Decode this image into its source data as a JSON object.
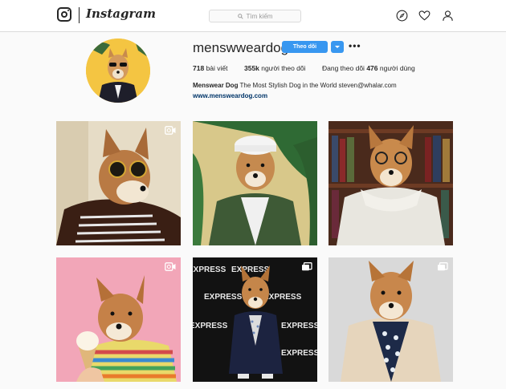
{
  "header": {
    "logo_text": "Instagram",
    "search_placeholder": "Tìm kiếm",
    "icons": [
      "instagram-camera-icon",
      "explore-compass-icon",
      "heart-icon",
      "profile-user-icon"
    ]
  },
  "profile": {
    "username": "menswweardog",
    "follow_label": "Theo dõi",
    "more_label": "•••",
    "stats": {
      "posts_count": "718",
      "posts_label": "bài viết",
      "followers_count": "355k",
      "followers_label": "người theo dõi",
      "following_prefix": "Đang theo dõi",
      "following_count": "476",
      "following_label": "người dùng"
    },
    "bio_name": "Menswear Dog",
    "bio_text": "The Most Stylish Dog in the World steven@whalar.com",
    "website": "www.mensweardog.com"
  },
  "posts": [
    {
      "kind": "video",
      "badge": "video-camera-icon"
    },
    {
      "kind": "photo",
      "badge": ""
    },
    {
      "kind": "photo",
      "badge": ""
    },
    {
      "kind": "video",
      "badge": "video-camera-icon"
    },
    {
      "kind": "carousel",
      "badge": "carousel-icon",
      "backdrop_text": [
        "EXPRESS",
        "EXPRESS",
        "EXPRESS",
        "EXPRESS",
        "EXPRESS",
        "EXPRESS",
        "EXPRESS"
      ]
    },
    {
      "kind": "carousel",
      "badge": "carousel-icon"
    }
  ],
  "colors": {
    "accent": "#3897f0",
    "link": "#003569",
    "text": "#262626",
    "border": "#dbdbdb"
  }
}
